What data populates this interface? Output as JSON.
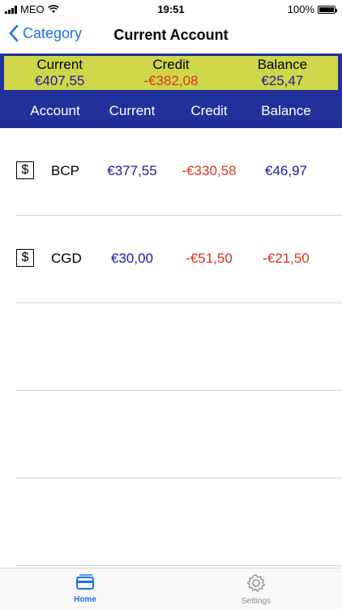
{
  "status": {
    "carrier": "MEO",
    "time": "19:51",
    "battery": "100%"
  },
  "nav": {
    "back_label": "Category",
    "title": "Current Account"
  },
  "summary": {
    "current_label": "Current",
    "current_value": "€407,55",
    "credit_label": "Credit",
    "credit_value": "-€382,08",
    "balance_label": "Balance",
    "balance_value": "€25,47"
  },
  "table": {
    "headers": [
      "Account",
      "Current",
      "Credit",
      "Balance"
    ],
    "rows": [
      {
        "icon": "$",
        "name": "BCP",
        "current": "€377,55",
        "credit": "-€330,58",
        "balance": "€46,97",
        "balance_negative": false
      },
      {
        "icon": "$",
        "name": "CGD",
        "current": "€30,00",
        "credit": "-€51,50",
        "balance": "-€21,50",
        "balance_negative": true
      }
    ]
  },
  "tabbar": {
    "home_label": "Home",
    "settings_label": "Settings"
  },
  "colors": {
    "accent": "#1a74e8",
    "header_bg": "#22309c",
    "summary_bg": "#cfd64a",
    "positive": "#1a1aa0",
    "negative": "#d7351e"
  },
  "icons": [
    "wifi-icon",
    "back-chevron-icon",
    "dollar-icon",
    "card-icon",
    "gear-icon"
  ]
}
